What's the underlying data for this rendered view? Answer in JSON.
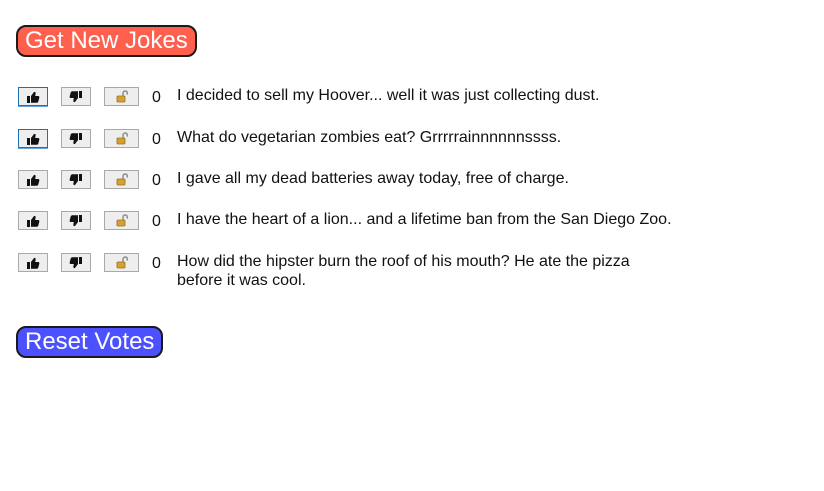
{
  "buttons": {
    "get_new_jokes": "Get New Jokes",
    "reset_votes": "Reset Votes"
  },
  "colors": {
    "get_button": "#ff5f4d",
    "reset_button": "#4b51ff",
    "lock_icon": "#d3a233"
  },
  "icons": {
    "upvote": "thumbs-up-icon",
    "downvote": "thumbs-down-icon",
    "lock": "unlocked-padlock-icon"
  },
  "jokes": [
    {
      "score": "0",
      "text": "I decided to sell my Hoover... well it was just collecting dust."
    },
    {
      "score": "0",
      "text": "What do vegetarian zombies eat? Grrrrrainnnnnnssss."
    },
    {
      "score": "0",
      "text": "I gave all my dead batteries away today, free of charge."
    },
    {
      "score": "0",
      "text": "I have the heart of a lion... and a lifetime ban from the San Diego Zoo."
    },
    {
      "score": "0",
      "text": "How did the hipster burn the roof of his mouth? He ate the pizza before it was cool."
    }
  ]
}
